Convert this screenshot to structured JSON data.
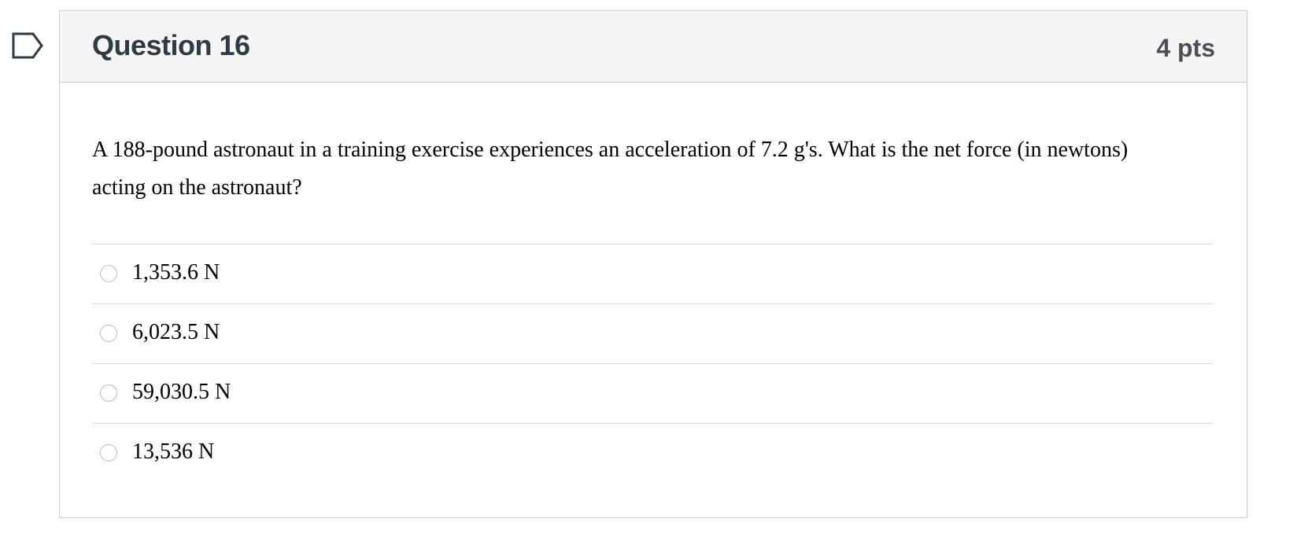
{
  "question": {
    "title": "Question 16",
    "points": "4 pts",
    "text": "A 188-pound astronaut in a training exercise experiences an acceleration of 7.2 g's.  What is the net force (in newtons) acting on the astronaut?",
    "flag_icon": "flag-question-icon"
  },
  "answers": [
    {
      "label": "1,353.6 N",
      "selected": false
    },
    {
      "label": "6,023.5 N",
      "selected": false
    },
    {
      "label": "59,030.5 N",
      "selected": false
    },
    {
      "label": "13,536 N",
      "selected": false
    }
  ],
  "colors": {
    "header_bg": "#f5f5f5",
    "border": "#c7cdd1",
    "title": "#2d3b45",
    "flag_stroke": "#2d3b45"
  }
}
